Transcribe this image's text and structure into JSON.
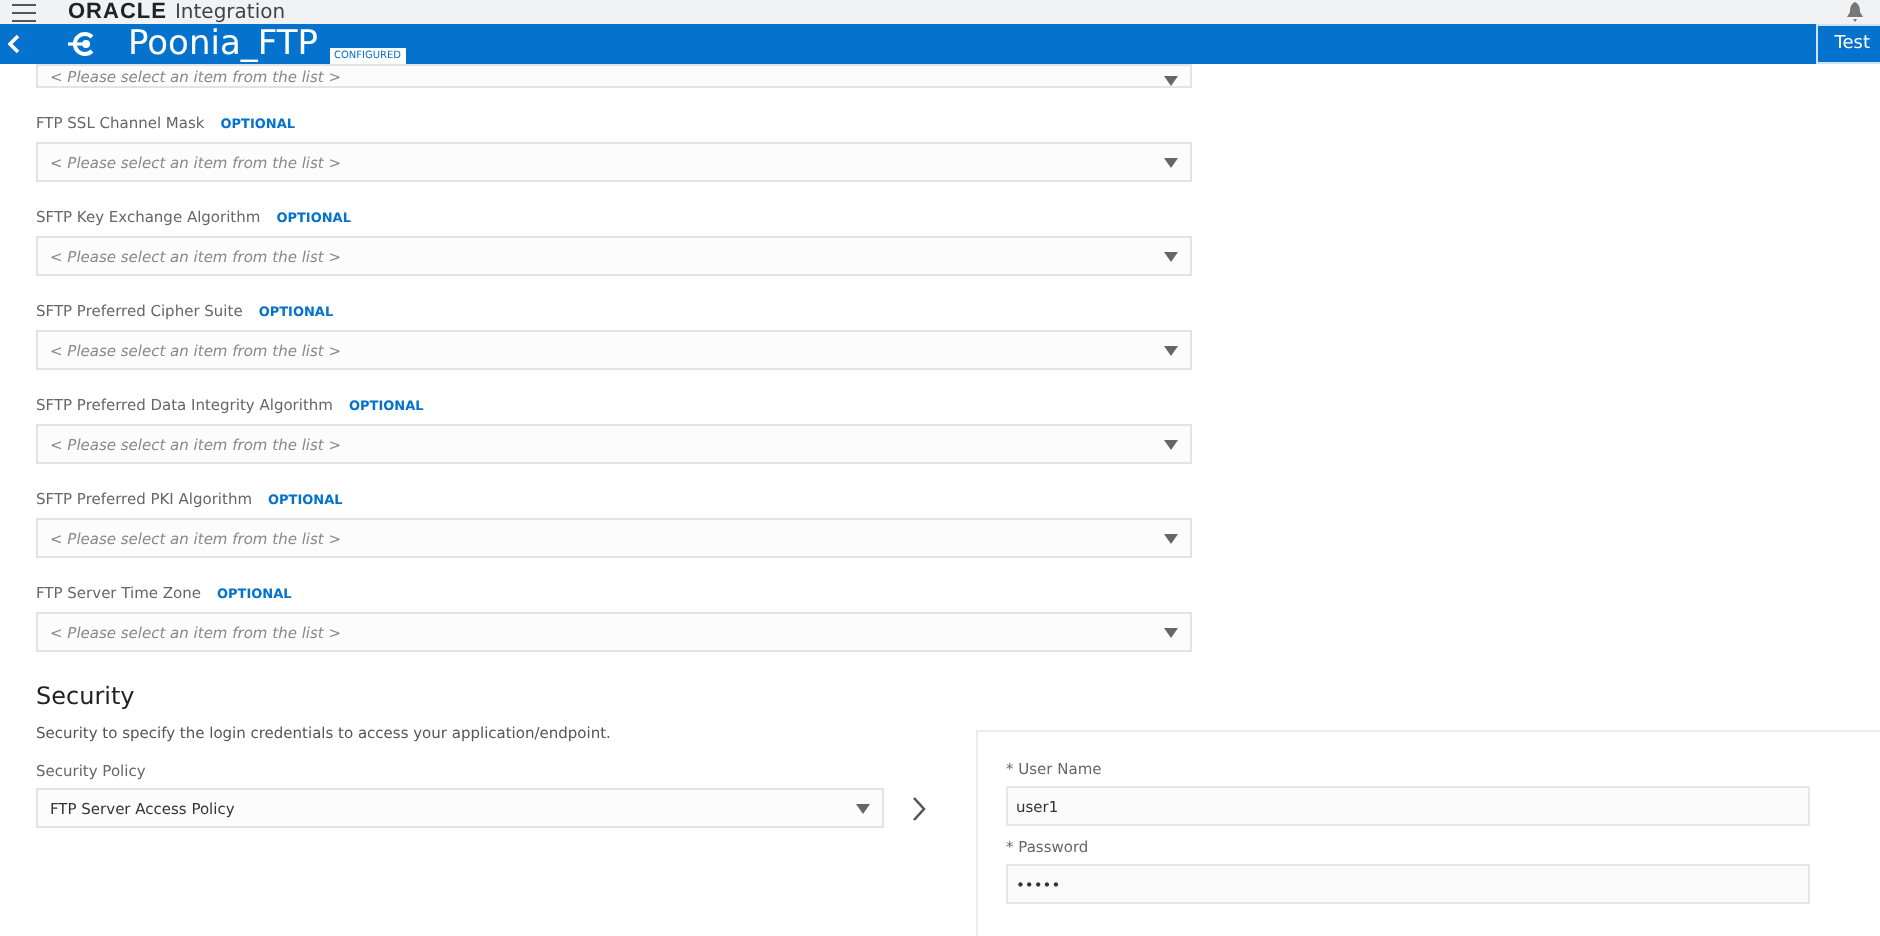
{
  "topbar": {
    "brand": "ORACLE",
    "product": "Integration"
  },
  "header": {
    "title": "Poonia_FTP",
    "badge": "CONFIGURED",
    "button": "Test"
  },
  "partial_field": {
    "placeholder": "< Please select an item from the list >"
  },
  "fields": [
    {
      "label": "FTP SSL Channel Mask",
      "tag": "OPTIONAL",
      "placeholder": "< Please select an item from the list >"
    },
    {
      "label": "SFTP Key Exchange Algorithm",
      "tag": "OPTIONAL",
      "placeholder": "< Please select an item from the list >"
    },
    {
      "label": "SFTP Preferred Cipher Suite",
      "tag": "OPTIONAL",
      "placeholder": "< Please select an item from the list >"
    },
    {
      "label": "SFTP Preferred Data Integrity Algorithm",
      "tag": "OPTIONAL",
      "placeholder": "< Please select an item from the list >"
    },
    {
      "label": "SFTP Preferred PKI Algorithm",
      "tag": "OPTIONAL",
      "placeholder": "< Please select an item from the list >"
    },
    {
      "label": "FTP Server Time Zone",
      "tag": "OPTIONAL",
      "placeholder": "< Please select an item from the list >"
    }
  ],
  "security": {
    "title": "Security",
    "description": "Security to specify the login credentials to access your application/endpoint.",
    "policy_label": "Security Policy",
    "policy_value": "FTP Server Access Policy",
    "credentials": [
      {
        "label": "User Name",
        "required_mark": "*",
        "value": "user1"
      },
      {
        "label": "Password",
        "required_mark": "*",
        "value": "•••••"
      }
    ]
  }
}
